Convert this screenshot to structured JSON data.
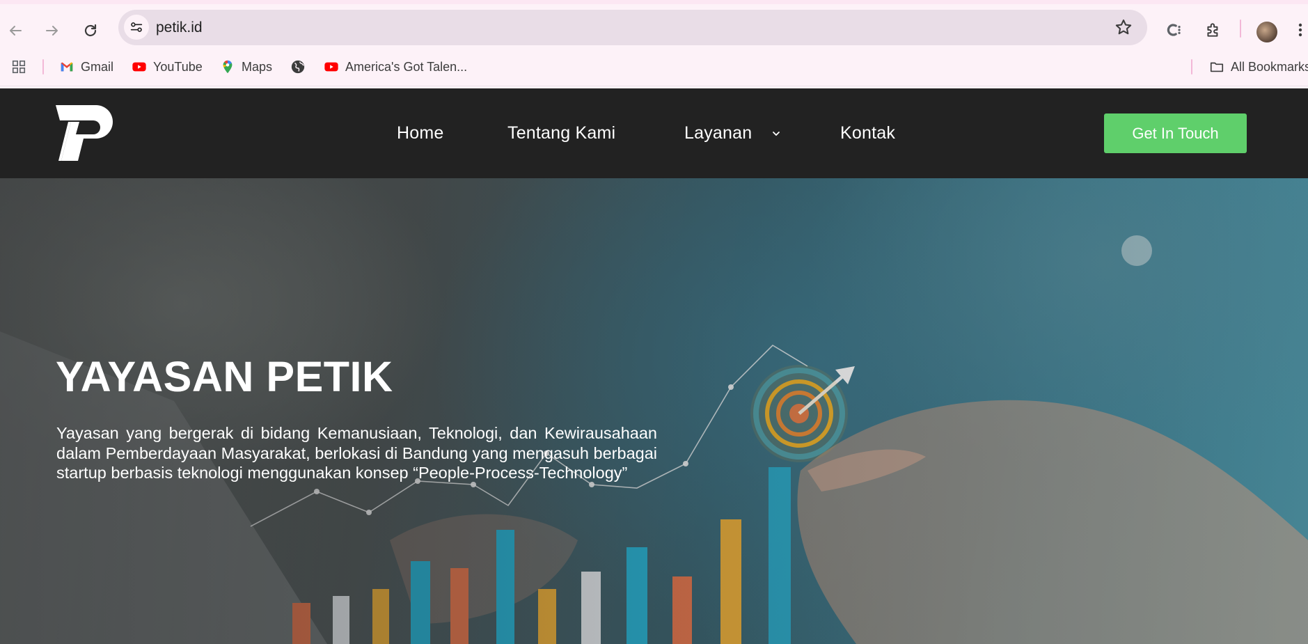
{
  "browser": {
    "url": "petik.id",
    "bookmarks": [
      {
        "label": "Gmail",
        "icon": "gmail-icon"
      },
      {
        "label": "YouTube",
        "icon": "youtube-icon"
      },
      {
        "label": "Maps",
        "icon": "maps-icon"
      },
      {
        "label": "",
        "icon": "globe-icon"
      },
      {
        "label": "America's Got Talen...",
        "icon": "youtube-icon"
      }
    ],
    "all_bookmarks_label": "All Bookmarks"
  },
  "site": {
    "nav": {
      "home": "Home",
      "about": "Tentang Kami",
      "services": "Layanan",
      "contact": "Kontak"
    },
    "cta_label": "Get In Touch",
    "hero": {
      "title": "YAYASAN PETIK",
      "description": "Yayasan yang bergerak di bidang Kemanusiaan, Teknologi, dan Kewirausahaan dalam Pemberdayaan Masyarakat, berlokasi di Bandung yang mengasuh berbagai startup berbasis teknologi menggunakan konsep “People-Process-Technology”"
    }
  },
  "colors": {
    "nav_bg": "#222222",
    "cta_bg": "#5fcf6b",
    "chrome_bg": "#fdf2f8",
    "omnibox_bg": "#e9dde7"
  }
}
